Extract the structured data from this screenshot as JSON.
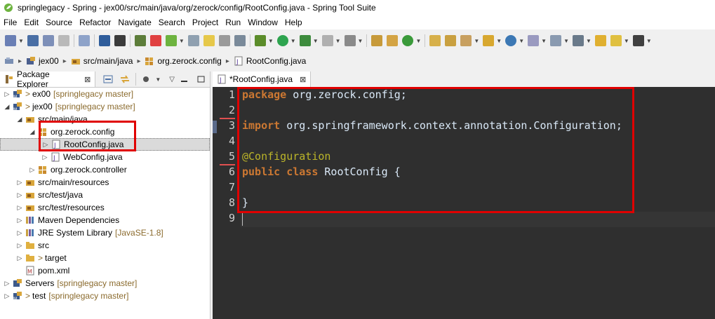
{
  "window": {
    "title": "springlegacy - Spring - jex00/src/main/java/org/zerock/config/RootConfig.java - Spring Tool Suite"
  },
  "menu": [
    "File",
    "Edit",
    "Source",
    "Refactor",
    "Navigate",
    "Search",
    "Project",
    "Run",
    "Window",
    "Help"
  ],
  "breadcrumb": [
    "jex00",
    "src/main/java",
    "org.zerock.config",
    "RootConfig.java"
  ],
  "explorer": {
    "tab_label": "Package Explorer",
    "tab_close": "⊠",
    "rows": [
      {
        "label": "ex00",
        "prefix": ">",
        "git": "[springlegacy master]",
        "twisty": "▷"
      },
      {
        "label": "jex00",
        "prefix": ">",
        "git": "[springlegacy master]",
        "twisty": "◢"
      },
      {
        "label": "src/main/java",
        "twisty": "◢"
      },
      {
        "label": "org.zerock.config",
        "twisty": "◢"
      },
      {
        "label": "RootConfig.java",
        "twisty": "▷"
      },
      {
        "label": "WebConfig.java",
        "twisty": "▷"
      },
      {
        "label": "org.zerock.controller",
        "twisty": "▷"
      },
      {
        "label": "src/main/resources",
        "twisty": "▷"
      },
      {
        "label": "src/test/java",
        "twisty": "▷"
      },
      {
        "label": "src/test/resources",
        "twisty": "▷"
      },
      {
        "label": "Maven Dependencies",
        "twisty": "▷"
      },
      {
        "label": "JRE System Library",
        "extra": "[JavaSE-1.8]",
        "twisty": "▷"
      },
      {
        "label": "src",
        "twisty": "▷"
      },
      {
        "label": "target",
        "prefix": ">",
        "twisty": "▷"
      },
      {
        "label": "pom.xml",
        "twisty": ""
      },
      {
        "label": "Servers",
        "git": "[springlegacy master]",
        "twisty": "▷"
      },
      {
        "label": "test",
        "prefix": ">",
        "git": "[springlegacy master]",
        "twisty": "▷"
      }
    ]
  },
  "editor": {
    "tab_label": "*RootConfig.java",
    "tab_close": "⊠",
    "line_numbers": [
      "1",
      "2",
      "3",
      "4",
      "5",
      "6",
      "7",
      "8",
      "9"
    ],
    "lines": {
      "l1_kw": "package",
      "l1_rest": " org.zerock.config;",
      "l3_kw": "import",
      "l3_rest": " org.springframework.context.annotation.Configuration;",
      "l5_ann": "@Configuration",
      "l6_kw1": "public",
      "l6_sp": " ",
      "l6_kw2": "class",
      "l6_rest": " RootConfig {",
      "l8": "}"
    }
  },
  "colors": {
    "highlight": "#e00000",
    "editor_bg": "#2f2f2f",
    "keyword": "#cc7832",
    "annotation": "#bbb529"
  }
}
